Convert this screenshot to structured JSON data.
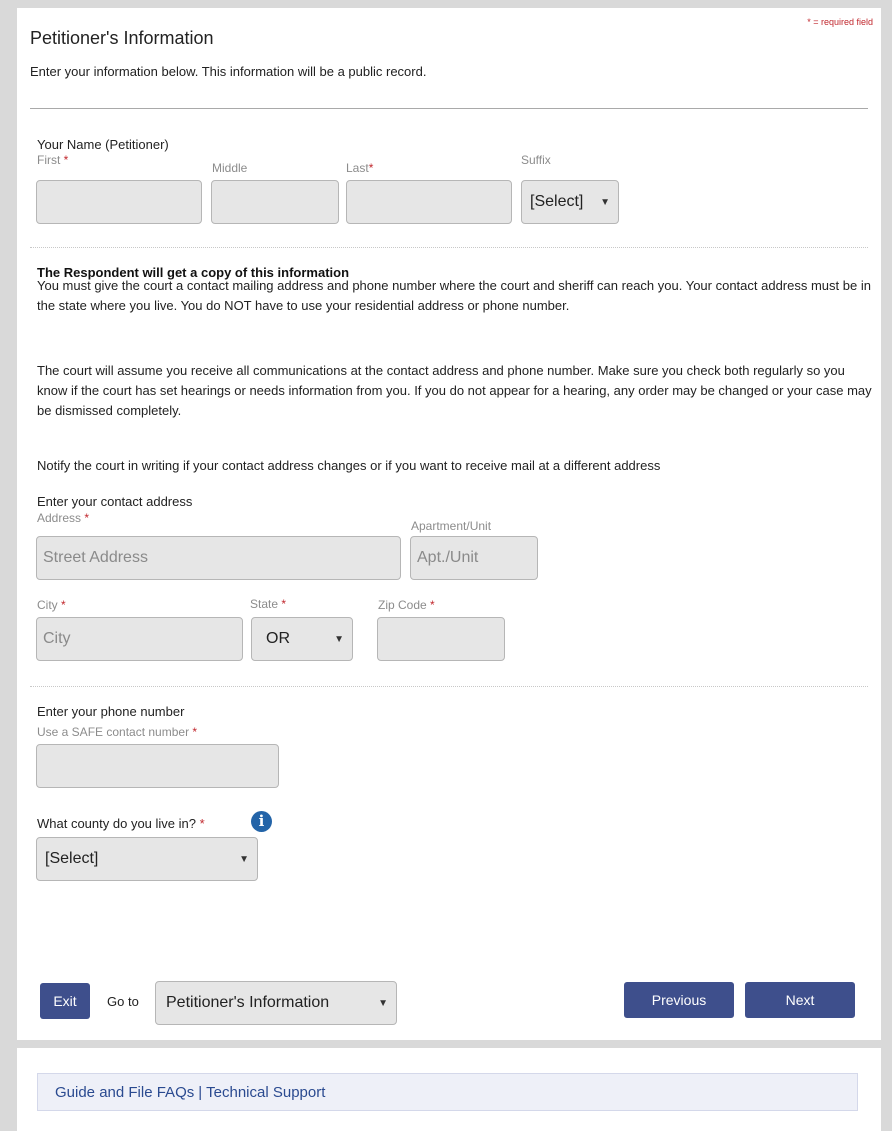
{
  "required_legend": {
    "star": "*",
    "text": " = required field"
  },
  "page": {
    "title": "Petitioner's Information",
    "intro": "Enter your information below. This information will be a public record."
  },
  "name_section": {
    "label": "Your Name (Petitioner)",
    "first_label": "First",
    "middle_label": "Middle",
    "last_label": "Last",
    "suffix_label": "Suffix",
    "first_value": "",
    "middle_value": "",
    "last_value": "",
    "suffix_selected": "[Select]"
  },
  "respondent_section": {
    "heading": "The Respondent will get a copy of this information",
    "para1": "You must give the court a contact mailing address and phone number where the court and sheriff can reach you. Your contact address must be in the state where you live. You do NOT have to use your residential address or phone number.",
    "para2": "The court will assume you receive all communications at the contact address and phone number. Make sure you check both regularly so you know if the court has set hearings or needs information from you. If you do not appear for a hearing, any order may be changed or your case may be dismissed completely.",
    "para3": "Notify the court in writing if your contact address changes or if you want to receive mail at a different address"
  },
  "address_section": {
    "label": "Enter your contact address",
    "address_label": "Address",
    "address_placeholder": "Street Address",
    "apt_label": "Apartment/Unit",
    "apt_placeholder": "Apt./Unit",
    "city_label": "City",
    "city_placeholder": "City",
    "state_label": "State",
    "state_selected": "OR",
    "zip_label": "Zip Code",
    "zip_value": ""
  },
  "phone_section": {
    "label": "Enter your phone number",
    "sublabel": "Use a SAFE contact number",
    "phone_value": ""
  },
  "county_section": {
    "label": "What county do you live in?",
    "selected": "[Select]",
    "info_icon": "info-icon"
  },
  "nav": {
    "exit_label": "Exit",
    "goto_label": "Go to",
    "goto_selected": "Petitioner's Information",
    "previous_label": "Previous",
    "next_label": "Next"
  },
  "footer": {
    "faq_link": "Guide and File FAQs",
    "separator": "|",
    "support_link": "Technical Support"
  },
  "colors": {
    "required": "#c1272d",
    "button": "#3e4f8c",
    "info_icon": "#2364a8",
    "link": "#2a4a90"
  }
}
